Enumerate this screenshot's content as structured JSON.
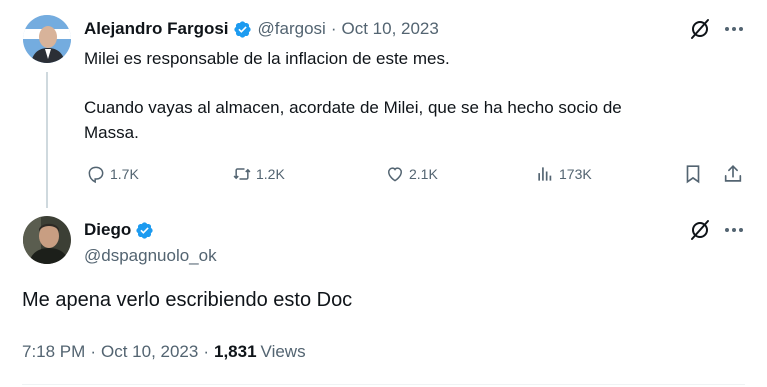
{
  "colors": {
    "text": "#0f1419",
    "muted": "#536471",
    "verified": "#1d9bf0",
    "divider": "#eff3f4",
    "thread_line": "#cfd9de"
  },
  "parent_tweet": {
    "display_name": "Alejandro Fargosi",
    "handle": "@fargosi",
    "separator": "·",
    "date": "Oct 10, 2023",
    "text_line1": "Milei es responsable de la inflacion de este mes.",
    "text_line2": "Cuando vayas al almacen, acordate de Milei, que se ha hecho socio de",
    "text_line3": "Massa.",
    "actions": {
      "replies": "1.7K",
      "reposts": "1.2K",
      "likes": "2.1K",
      "views": "173K"
    },
    "icons": [
      "grok-icon",
      "more-icon",
      "reply-icon",
      "repost-icon",
      "like-icon",
      "views-icon",
      "bookmark-icon",
      "share-icon"
    ]
  },
  "main_tweet": {
    "display_name": "Diego",
    "handle": "@dspagnuolo_ok",
    "text": "Me apena verlo escribiendo esto Doc",
    "time": "7:18 PM",
    "separator": "·",
    "date": "Oct 10, 2023",
    "view_count": "1,831",
    "views_label": "Views",
    "icons": [
      "grok-icon",
      "more-icon"
    ]
  }
}
